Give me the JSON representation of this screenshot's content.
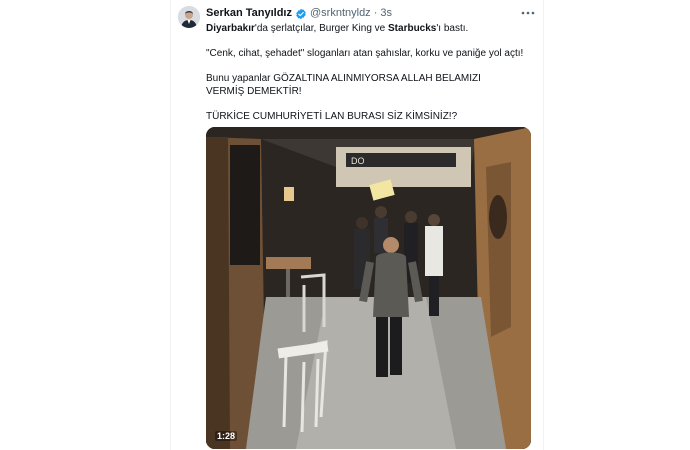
{
  "tweet": {
    "author_name": "Serkan Tanyıldız",
    "handle": "@srkntnyldz",
    "separator": "·",
    "time": "3s",
    "more_icon": "more-horizontal-icon",
    "verified_icon": "verified-badge-icon",
    "colors": {
      "verified": "#1d9bf0",
      "text": "#0f1419",
      "secondary": "#536471"
    },
    "text": {
      "line1_bold1": "Diyarbakır",
      "line1_part1": "'da şerlatçılar, Burger King ve ",
      "line1_bold2": "Starbucks",
      "line1_part2": "'ı bastı.",
      "paragraph2": "\"Cenk, cihat, şehadet\" sloganları atan şahıslar, korku ve paniğe yol açtı!",
      "paragraph3": "Bunu yapanlar GÖZALTINA ALINMIYORSA ALLAH BELAMIZI VERMİŞ DEMEKTİR!",
      "paragraph4": "TÜRKİCE CUMHURİYETİ LAN BURASI SİZ KİMSİNİZ!?"
    },
    "video": {
      "duration": "1:28",
      "sign_text": "DO"
    }
  }
}
